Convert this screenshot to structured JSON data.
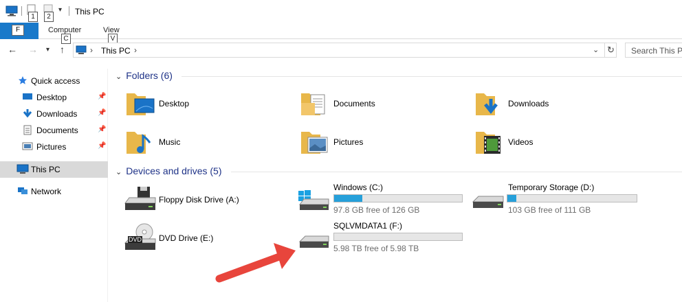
{
  "window": {
    "title": "This PC"
  },
  "quick_access_keys": [
    "1",
    "2"
  ],
  "ribbon": {
    "file_key": "F",
    "tabs": [
      {
        "label": "Computer",
        "key": "C"
      },
      {
        "label": "View",
        "key": "V"
      }
    ]
  },
  "address": {
    "path": "This PC",
    "search_placeholder": "Search This PC"
  },
  "sidebar": {
    "quick_access": "Quick access",
    "items": [
      {
        "label": "Desktop"
      },
      {
        "label": "Downloads"
      },
      {
        "label": "Documents"
      },
      {
        "label": "Pictures"
      }
    ],
    "this_pc": "This PC",
    "network": "Network"
  },
  "folders": {
    "header": "Folders (6)",
    "items": [
      {
        "label": "Desktop"
      },
      {
        "label": "Documents"
      },
      {
        "label": "Downloads"
      },
      {
        "label": "Music"
      },
      {
        "label": "Pictures"
      },
      {
        "label": "Videos"
      }
    ]
  },
  "drives": {
    "header": "Devices and drives (5)",
    "items": [
      {
        "label": "Floppy Disk Drive (A:)"
      },
      {
        "label": "Windows (C:)",
        "free": "97.8 GB free of 126 GB",
        "used_fraction": 0.22
      },
      {
        "label": "Temporary Storage (D:)",
        "free": "103 GB free of 111 GB",
        "used_fraction": 0.07
      },
      {
        "label": "DVD Drive (E:)",
        "badge": "DVD"
      },
      {
        "label": "SQLVMDATA1 (F:)",
        "free": "5.98 TB free of 5.98 TB",
        "used_fraction": 0.0
      }
    ]
  },
  "colors": {
    "accent": "#1979ca",
    "bar_fill": "#26a0da",
    "arrow": "#e8453c",
    "header_text": "#1e3287"
  }
}
